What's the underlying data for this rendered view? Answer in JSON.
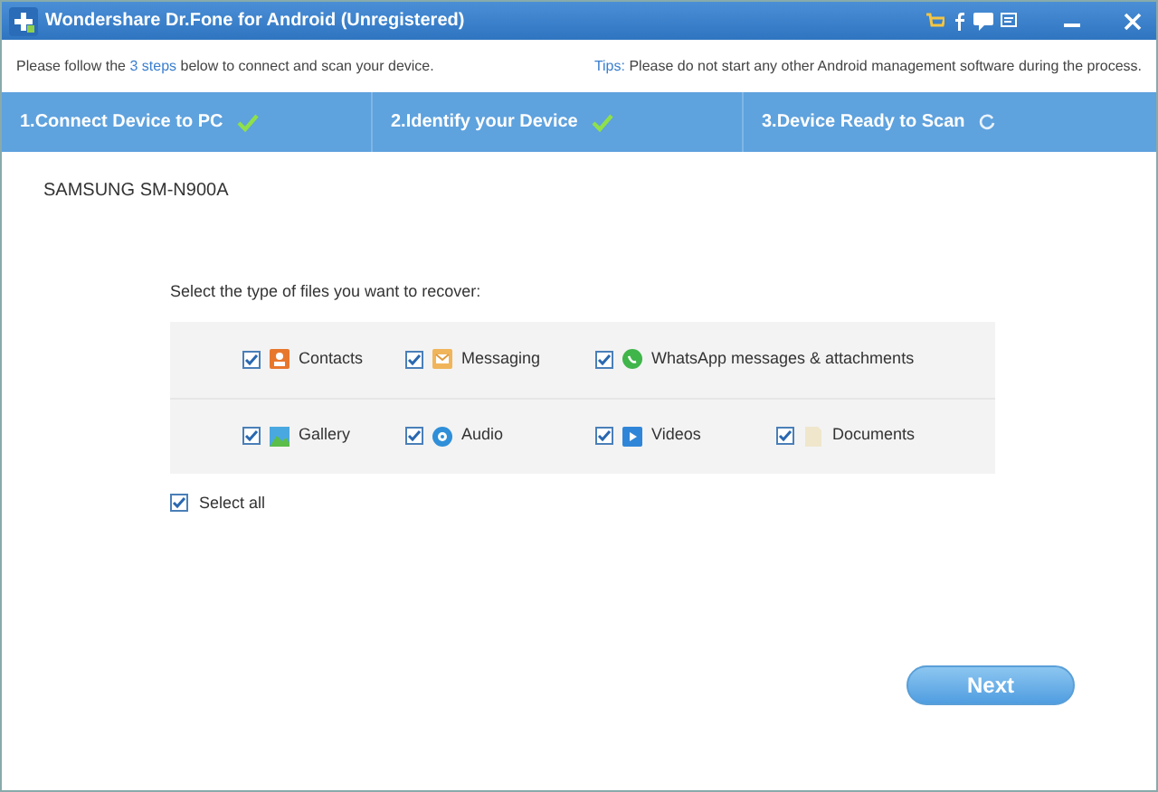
{
  "window": {
    "title": "Wondershare Dr.Fone for Android (Unregistered)"
  },
  "instruction": {
    "before": "Please follow the",
    "link": "3 steps",
    "after": "below to connect and scan your device."
  },
  "tips": {
    "label": "Tips:",
    "text": "Please do not start any other Android management software during the process."
  },
  "steps": [
    {
      "label": "1.Connect Device to PC",
      "done": true
    },
    {
      "label": "2.Identify your Device",
      "done": true
    },
    {
      "label": "3.Device Ready to Scan",
      "done": false
    }
  ],
  "device": "SAMSUNG SM-N900A",
  "prompt": "Select the type of files you want to recover:",
  "file_types": [
    [
      {
        "label": "Contacts",
        "kind": "contacts",
        "checked": true
      },
      {
        "label": "Messaging",
        "kind": "messaging",
        "checked": true
      },
      {
        "label": "WhatsApp messages & attachments",
        "kind": "whatsapp",
        "checked": true
      }
    ],
    [
      {
        "label": "Gallery",
        "kind": "gallery",
        "checked": true
      },
      {
        "label": "Audio",
        "kind": "audio",
        "checked": true
      },
      {
        "label": "Videos",
        "kind": "videos",
        "checked": true
      },
      {
        "label": "Documents",
        "kind": "documents",
        "checked": true
      }
    ]
  ],
  "select_all": {
    "label": "Select all",
    "checked": true
  },
  "next_button": "Next"
}
